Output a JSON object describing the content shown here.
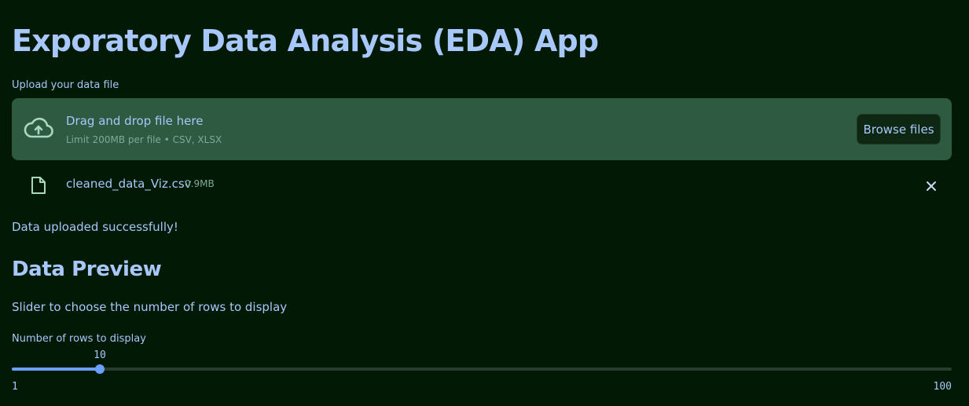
{
  "app": {
    "title": "Exporatory Data Analysis (EDA) App"
  },
  "uploader": {
    "label": "Upload your data file",
    "drop_title": "Drag and drop file here",
    "drop_subtitle": "Limit 200MB per file • CSV, XLSX",
    "browse_label": "Browse files",
    "icon": "cloud-upload-icon"
  },
  "uploaded_file": {
    "name": "cleaned_data_Viz.csv",
    "size": "0.9MB",
    "icon": "file-icon",
    "remove_icon": "close-icon"
  },
  "status": {
    "message": "Data uploaded successfully!"
  },
  "preview": {
    "heading": "Data Preview",
    "description": "Slider to choose the number of rows to display"
  },
  "slider": {
    "label": "Number of rows to display",
    "min": 1,
    "max": 100,
    "value": 10,
    "min_label": "1",
    "max_label": "100",
    "value_label": "10"
  },
  "colors": {
    "background": "#011905",
    "text": "#a8c7fa",
    "dropzone": "#2e5a42",
    "accent": "#6ba0ff"
  }
}
